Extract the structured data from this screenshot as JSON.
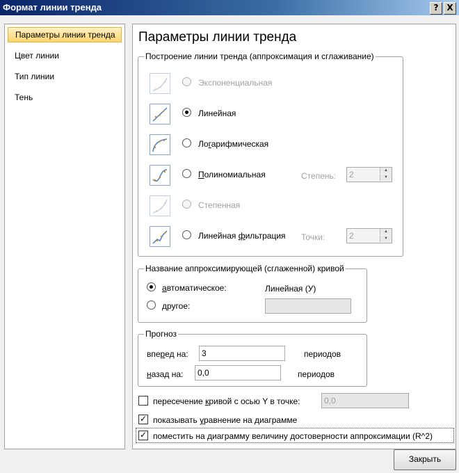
{
  "window": {
    "title": "Формат линии тренда",
    "help_label": "?",
    "close_label": "X"
  },
  "nav": {
    "items": [
      {
        "label": "Параметры линии тренда",
        "selected": true
      },
      {
        "label": "Цвет линии",
        "selected": false
      },
      {
        "label": "Тип линии",
        "selected": false
      },
      {
        "label": "Тень",
        "selected": false
      }
    ]
  },
  "main": {
    "title": "Параметры линии тренда",
    "trend_group": {
      "legend": "Построение линии тренда (аппроксимация и сглаживание)",
      "options": [
        {
          "label": "Экспоненциальная",
          "enabled": false,
          "selected": false
        },
        {
          "label": "Линейная",
          "enabled": true,
          "selected": true
        },
        {
          "label": "Логарифмическая",
          "enabled": true,
          "selected": false
        },
        {
          "label": "Полиномиальная",
          "enabled": true,
          "selected": false
        },
        {
          "label": "Степенная",
          "enabled": false,
          "selected": false
        },
        {
          "label": "Линейная фильтрация",
          "enabled": true,
          "selected": false
        }
      ],
      "degree_label": "Степень:",
      "degree_value": "2",
      "points_label": "Точки:",
      "points_value": "2"
    },
    "name_group": {
      "legend": "Название аппроксимирующей (сглаженной) кривой",
      "auto_label": "автоматическое:",
      "auto_value": "Линейная (У)",
      "other_label": "другое:",
      "other_value": ""
    },
    "forecast_group": {
      "legend": "Прогноз",
      "forward_label": "вперед на:",
      "forward_value": "3",
      "forward_unit": "периодов",
      "backward_label": "назад на:",
      "backward_value": "0,0",
      "backward_unit": "периодов"
    },
    "intercept": {
      "label": "пересечение кривой с осью Y в точке:",
      "value": "0,0",
      "checked": false
    },
    "show_equation": {
      "label": "показывать уравнение на диаграмме",
      "checked": true
    },
    "show_r2": {
      "label": "поместить на диаграмму величину достоверности аппроксимации (R^2)",
      "checked": true
    }
  },
  "buttons": {
    "close": "Закрыть"
  }
}
